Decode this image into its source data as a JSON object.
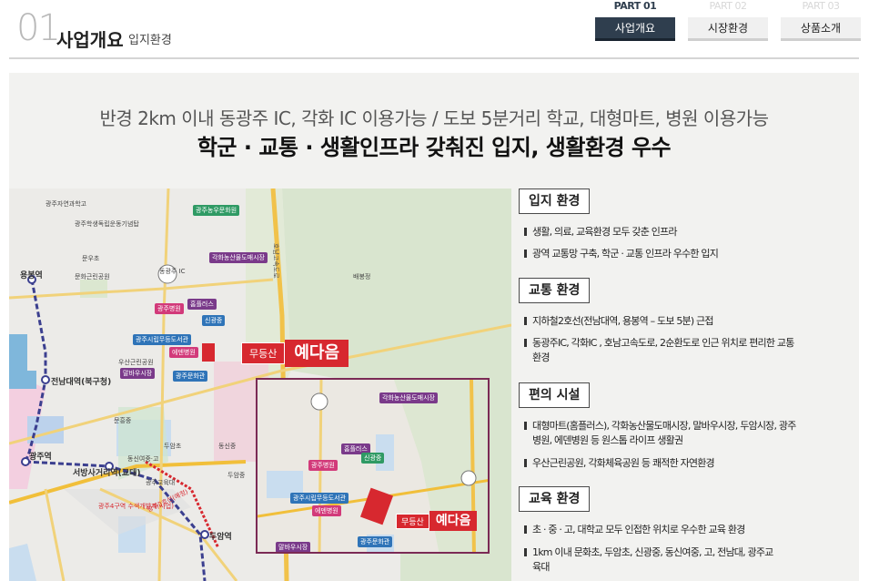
{
  "header": {
    "section_number": "01",
    "title": "사업개요",
    "subtitle": "입지환경"
  },
  "tabs": [
    {
      "part": "PART 01",
      "label": "사업개요",
      "active": true
    },
    {
      "part": "PART 02",
      "label": "시장환경",
      "active": false
    },
    {
      "part": "PART 03",
      "label": "상품소개",
      "active": false
    }
  ],
  "headline": {
    "line1": "반경 2km 이내 동광주 IC, 각화 IC 이용가능 / 도보 5분거리 학교, 대형마트, 병원 이용가능",
    "line2": "학군 · 교통 · 생활인프라 갖춰진 입지, 생활환경 우수"
  },
  "map": {
    "callout_small": "무등산",
    "callout_large": "예다음",
    "inset_callout_small": "무등산",
    "inset_callout_large": "예다음",
    "tags": {
      "nongsan_market": "각화농산물도매시장",
      "homeplus": "홈플러스",
      "gwangju_hospital": "광주병원",
      "sinchang_school": "신광중",
      "gwangju_book": "광주시립무등도서관",
      "eden_hospital": "에덴병원",
      "malba_market": "말바우시장",
      "gwangju_sports": "광주문화관",
      "gwangju_school_top": "광주농우문화원"
    },
    "labels": {
      "ic1": "동광주 IC",
      "ic_road": "호남고속도로",
      "station1": "용봉역",
      "station2": "전남대역(북구청)",
      "station3": "광주역",
      "station4": "서방사거리역(교대)",
      "station5": "두암역",
      "park": "우산근린공원",
      "mountain": "배봉정",
      "school1": "광주자연과학고",
      "school2": "광주학생독립운동기념탑",
      "school3": "문우초",
      "school4": "문화근린공원",
      "school5": "두암초",
      "school6": "동신여중·고",
      "school7": "광주교육대",
      "school8": "문흥중",
      "school9": "동신중",
      "school10": "두암중",
      "line2": "광주2호선(예정)",
      "line4": "광주4구역 수색개발제(사업)"
    }
  },
  "sections": [
    {
      "title": "입지 환경",
      "bullets": [
        "생활, 의료, 교육환경 모두 갖춘 인프라",
        "광역 교통망 구축, 학군 · 교통 인프라 우수한 입지"
      ]
    },
    {
      "title": "교통 환경",
      "bullets": [
        "지하철2호선(전남대역, 용봉역 – 도보 5분) 근접",
        "동광주IC, 각화IC , 호남고속도로, 2순환도로 인근 위치로 편리한 교통환경"
      ]
    },
    {
      "title": "편의 시설",
      "bullets": [
        "대형마트(홈플러스), 각화농산물도매시장, 말바우시장, 두암시장, 광주병원, 에덴병원 등 원스톱 라이프 생활권",
        "우산근린공원, 각화체육공원 등 쾌적한 자연환경"
      ]
    },
    {
      "title": "교육 환경",
      "bullets": [
        "초 · 중 · 고, 대학교 모두 인접한 위치로 우수한 교육 환경",
        "1km 이내 문화초, 두암초, 신광중, 동신여중, 고, 전남대, 광주교육대"
      ]
    }
  ],
  "colors": {
    "accent": "#d7282f",
    "tab_active": "#2f3e4e",
    "inset_border": "#7b2a55"
  }
}
